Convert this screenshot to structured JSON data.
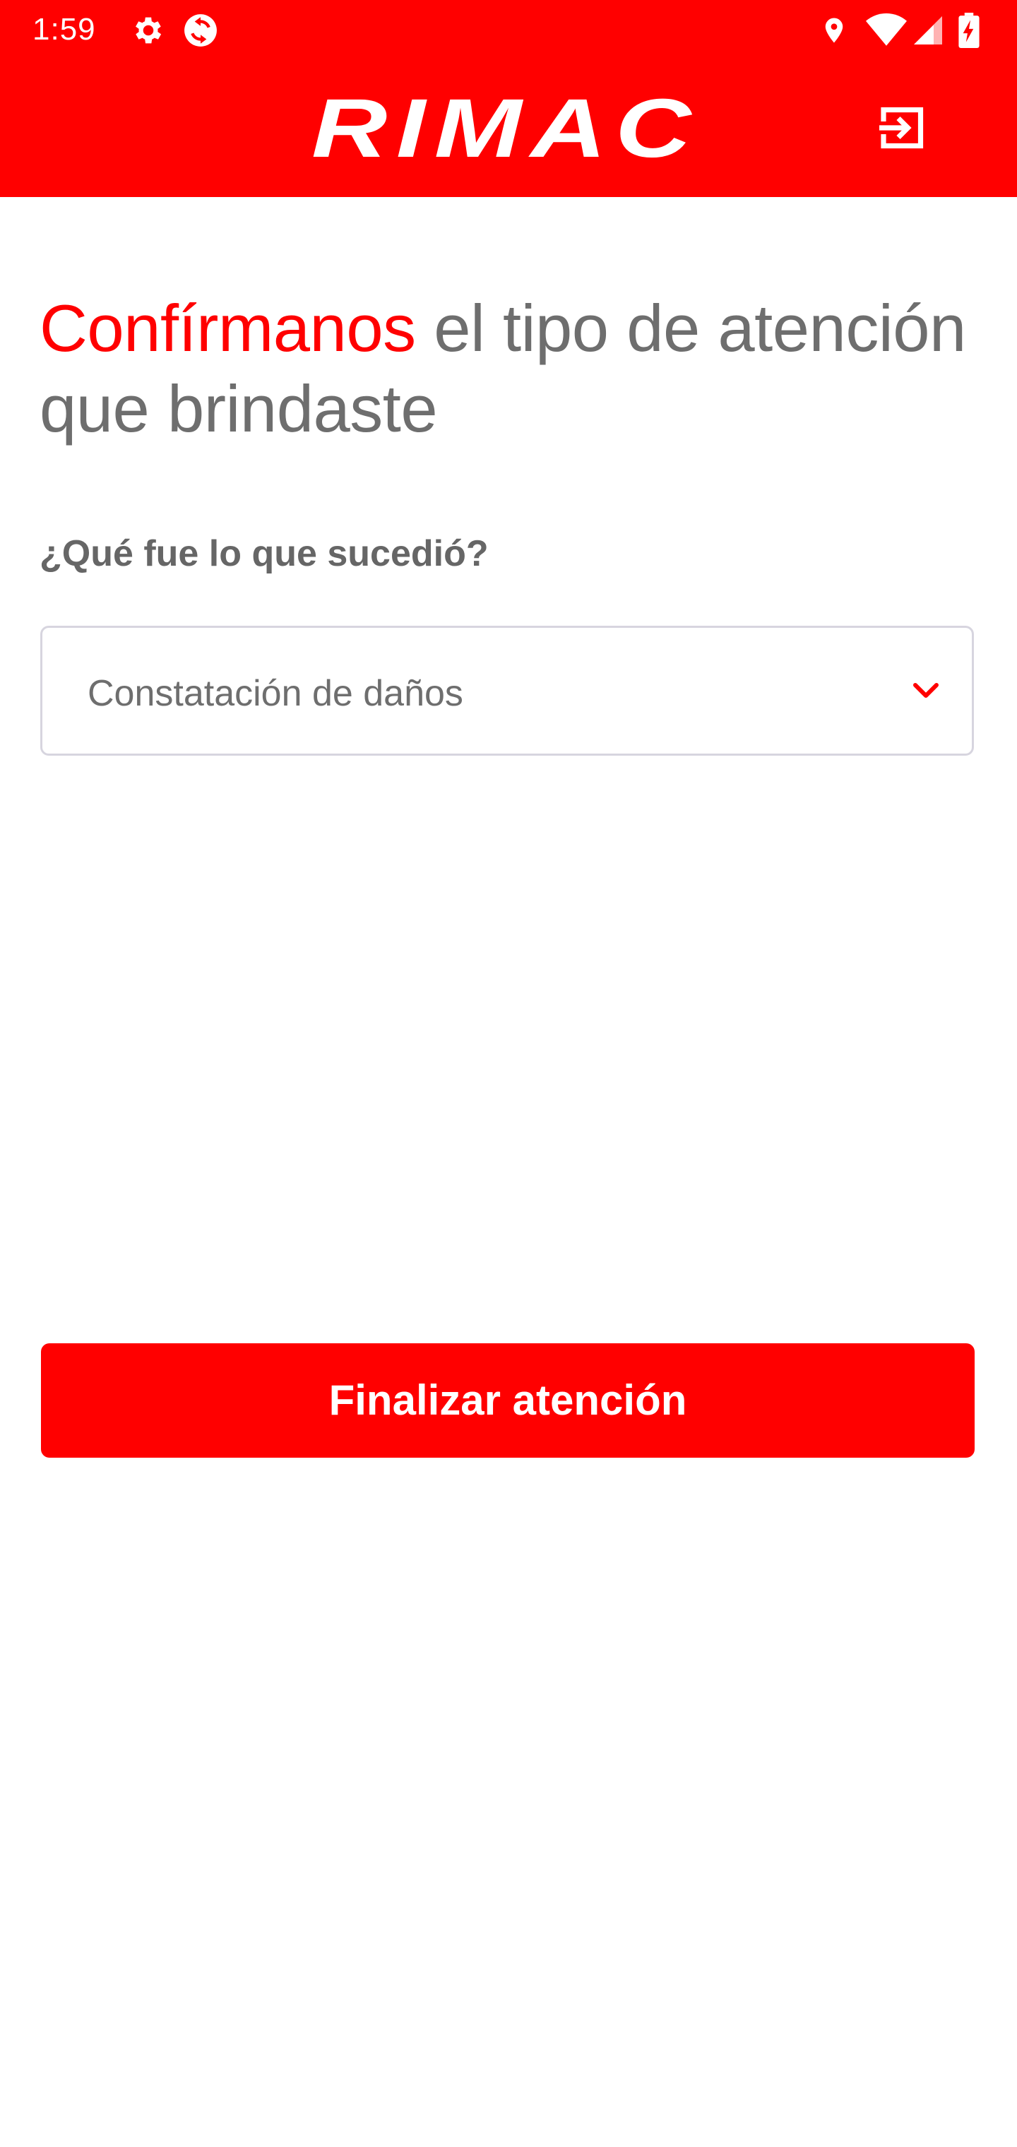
{
  "status_bar": {
    "time": "1:59",
    "left_icons": [
      "settings-gear-icon",
      "sync-app-icon"
    ],
    "right_icons": [
      "location-pin-icon",
      "wifi-icon",
      "cellular-signal-icon",
      "battery-charging-icon"
    ]
  },
  "header": {
    "logo_text": "RIMAC",
    "exit_icon": "logout-icon",
    "background_color": "#ff0000"
  },
  "main": {
    "headline_accent": "Confírmanos",
    "headline_rest": " el tipo de atención que brindaste",
    "question_label": "¿Qué fue lo que sucedió?",
    "select": {
      "value": "Constatación de daños",
      "icon": "chevron-down-icon"
    },
    "submit_label": "Finalizar atención"
  },
  "colors": {
    "brand_red": "#ff0000",
    "text_gray": "#6e6e6e",
    "border_gray": "#d7d5df"
  }
}
